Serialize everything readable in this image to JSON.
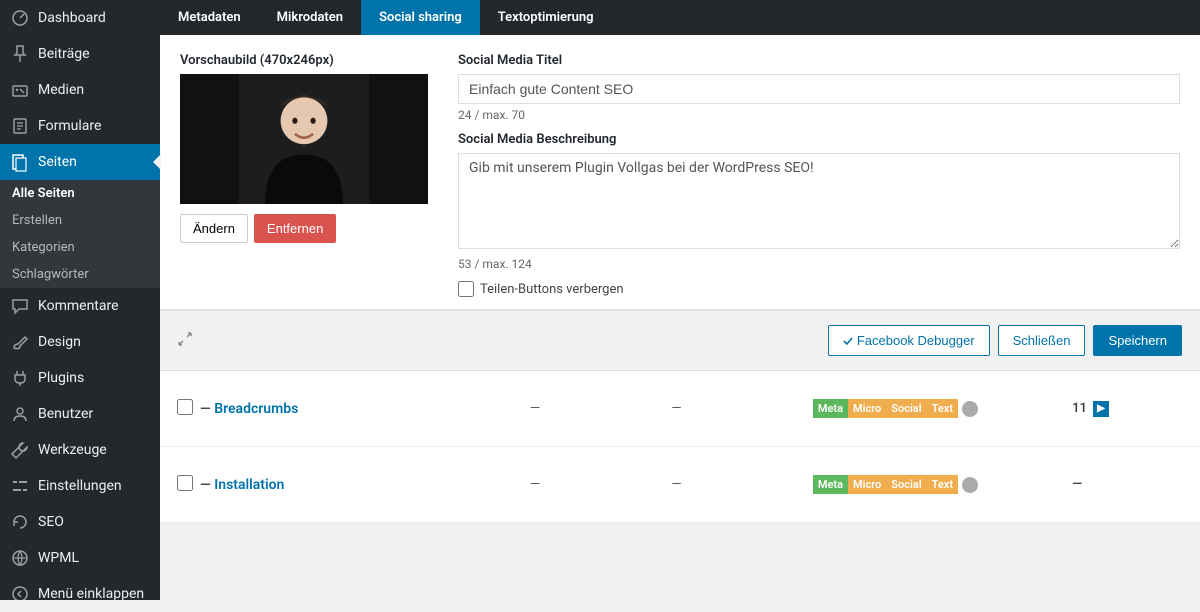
{
  "sidebar": {
    "items": [
      {
        "label": "Dashboard",
        "icon": "dashboard"
      },
      {
        "label": "Beiträge",
        "icon": "pin"
      },
      {
        "label": "Medien",
        "icon": "media"
      },
      {
        "label": "Formulare",
        "icon": "form"
      },
      {
        "label": "Seiten",
        "icon": "page",
        "current": true,
        "sub": [
          {
            "label": "Alle Seiten",
            "active": true
          },
          {
            "label": "Erstellen"
          },
          {
            "label": "Kategorien"
          },
          {
            "label": "Schlagwörter"
          }
        ]
      },
      {
        "label": "Kommentare",
        "icon": "comment"
      },
      {
        "label": "Design",
        "icon": "brush"
      },
      {
        "label": "Plugins",
        "icon": "plug"
      },
      {
        "label": "Benutzer",
        "icon": "user"
      },
      {
        "label": "Werkzeuge",
        "icon": "tool"
      },
      {
        "label": "Einstellungen",
        "icon": "settings"
      },
      {
        "label": "SEO",
        "icon": "seo"
      },
      {
        "label": "WPML",
        "icon": "wpml"
      },
      {
        "label": "Menü einklappen",
        "icon": "collapse"
      }
    ]
  },
  "tabs": [
    {
      "label": "Metadaten"
    },
    {
      "label": "Mikrodaten"
    },
    {
      "label": "Social sharing",
      "active": true
    },
    {
      "label": "Textoptimierung"
    }
  ],
  "panel": {
    "thumb_label": "Vorschaubild (470x246px)",
    "change_btn": "Ändern",
    "remove_btn": "Entfernen",
    "title_label": "Social Media Titel",
    "title_value": "Einfach gute Content SEO",
    "title_counter": "24 / max. 70",
    "desc_label": "Social Media Beschreibung",
    "desc_value": "Gib mit unserem Plugin Vollgas bei der WordPress SEO!",
    "desc_counter": "53 / max. 124",
    "hide_buttons": "Teilen-Buttons verbergen"
  },
  "actions": {
    "fb": "Facebook Debugger",
    "close": "Schließen",
    "save": "Speichern"
  },
  "rows": [
    {
      "title": "Breadcrumbs",
      "c1": "—",
      "c2": "—",
      "badges": [
        "Meta",
        "Micro",
        "Social",
        "Text"
      ],
      "score": "11",
      "show_sq": true
    },
    {
      "title": "Installation",
      "c1": "—",
      "c2": "—",
      "badges": [
        "Meta",
        "Micro",
        "Social",
        "Text"
      ],
      "score": "—",
      "show_sq": false
    }
  ]
}
